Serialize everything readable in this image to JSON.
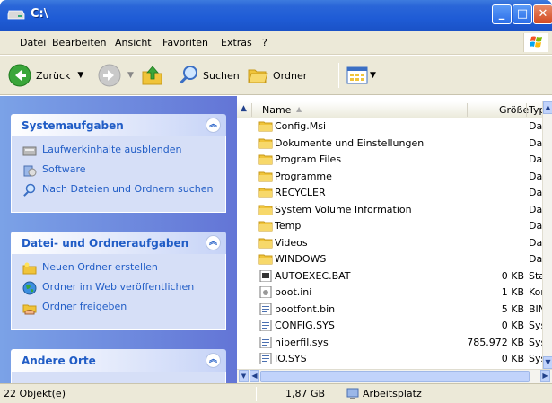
{
  "window": {
    "title": "C:\\"
  },
  "menu": [
    "Datei",
    "Bearbeiten",
    "Ansicht",
    "Favoriten",
    "Extras",
    "?"
  ],
  "toolbar": {
    "back_label": "Zurück",
    "search_label": "Suchen",
    "folders_label": "Ordner"
  },
  "left_pane": {
    "system_tasks": {
      "title": "Systemaufgaben",
      "items": [
        "Laufwerkinhalte ausblenden",
        "Software",
        "Nach Dateien und Ordnern suchen"
      ]
    },
    "file_tasks": {
      "title": "Datei- und Ordneraufgaben",
      "items": [
        "Neuen Ordner erstellen",
        "Ordner im Web veröffentlichen",
        "Ordner freigeben"
      ]
    },
    "other_places": {
      "title": "Andere Orte"
    }
  },
  "file_list": {
    "columns": {
      "name": "Name",
      "size": "Größe",
      "type": "Typ"
    },
    "rows": [
      {
        "name": "Config.Msi",
        "size": "",
        "type": "Dat",
        "icon": "folder-icon"
      },
      {
        "name": "Dokumente und Einstellungen",
        "size": "",
        "type": "Dat",
        "icon": "folder-icon"
      },
      {
        "name": "Program Files",
        "size": "",
        "type": "Dat",
        "icon": "folder-icon"
      },
      {
        "name": "Programme",
        "size": "",
        "type": "Dat",
        "icon": "folder-icon"
      },
      {
        "name": "RECYCLER",
        "size": "",
        "type": "Dat",
        "icon": "folder-icon"
      },
      {
        "name": "System Volume Information",
        "size": "",
        "type": "Dat",
        "icon": "folder-icon"
      },
      {
        "name": "Temp",
        "size": "",
        "type": "Dat",
        "icon": "folder-icon"
      },
      {
        "name": "Videos",
        "size": "",
        "type": "Dat",
        "icon": "folder-icon"
      },
      {
        "name": "WINDOWS",
        "size": "",
        "type": "Dat",
        "icon": "folder-icon"
      },
      {
        "name": "AUTOEXEC.BAT",
        "size": "0 KB",
        "type": "Sta",
        "icon": "batch-file-icon"
      },
      {
        "name": "boot.ini",
        "size": "1 KB",
        "type": "Kor",
        "icon": "settings-file-icon"
      },
      {
        "name": "bootfont.bin",
        "size": "5 KB",
        "type": "BIN",
        "icon": "file-icon"
      },
      {
        "name": "CONFIG.SYS",
        "size": "0 KB",
        "type": "Sys",
        "icon": "file-icon"
      },
      {
        "name": "hiberfil.sys",
        "size": "785.972 KB",
        "type": "Sys",
        "icon": "file-icon"
      },
      {
        "name": "IO.SYS",
        "size": "0 KB",
        "type": "Sys",
        "icon": "file-icon"
      }
    ]
  },
  "status": {
    "objects": "22 Objekt(e)",
    "size": "1,87 GB",
    "location": "Arbeitsplatz"
  }
}
